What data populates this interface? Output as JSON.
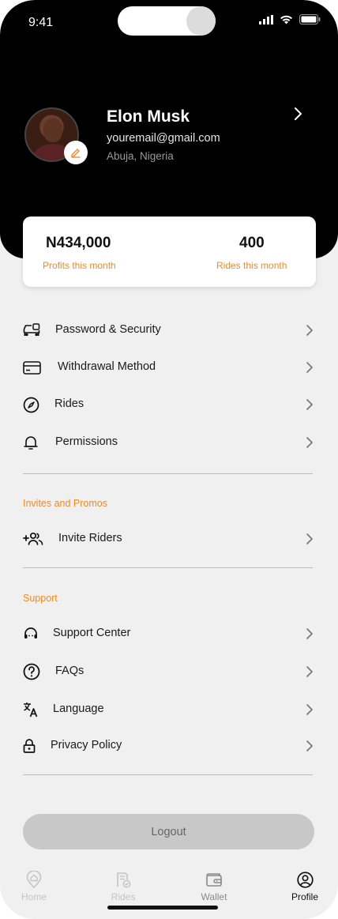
{
  "status_bar": {
    "time": "9:41"
  },
  "profile": {
    "name": "Elon Musk",
    "email": "youremail@gmail.com",
    "location": "Abuja, Nigeria"
  },
  "stats": {
    "profit_value": "N434,000",
    "profit_label": "Profits this month",
    "rides_value": "400",
    "rides_label": "Rides this month"
  },
  "menu": {
    "account": [
      {
        "label": "Password & Security",
        "icon": "car-security-icon"
      },
      {
        "label": "Withdrawal Method",
        "icon": "credit-card-icon"
      },
      {
        "label": "Rides",
        "icon": "compass-icon"
      },
      {
        "label": "Permissions",
        "icon": "bell-icon"
      }
    ],
    "invites_title": "Invites and Promos",
    "invites": [
      {
        "label": "Invite Riders",
        "icon": "add-users-icon"
      }
    ],
    "support_title": "Support",
    "support": [
      {
        "label": "Support Center",
        "icon": "headset-icon"
      },
      {
        "label": "FAQs",
        "icon": "question-icon"
      },
      {
        "label": "Language",
        "icon": "translate-icon"
      },
      {
        "label": "Privacy Policy",
        "icon": "lock-icon"
      }
    ]
  },
  "logout_label": "Logout",
  "tabs": [
    {
      "label": "Home",
      "icon": "home-pin-icon"
    },
    {
      "label": "Rides",
      "icon": "rides-receipt-icon"
    },
    {
      "label": "Wallet",
      "icon": "wallet-icon"
    },
    {
      "label": "Profile",
      "icon": "profile-icon"
    }
  ],
  "colors": {
    "accent": "#f08a2c",
    "header_bg": "#000000",
    "page_bg": "#f0f0f0",
    "logout_bg": "#c8c8c8"
  }
}
